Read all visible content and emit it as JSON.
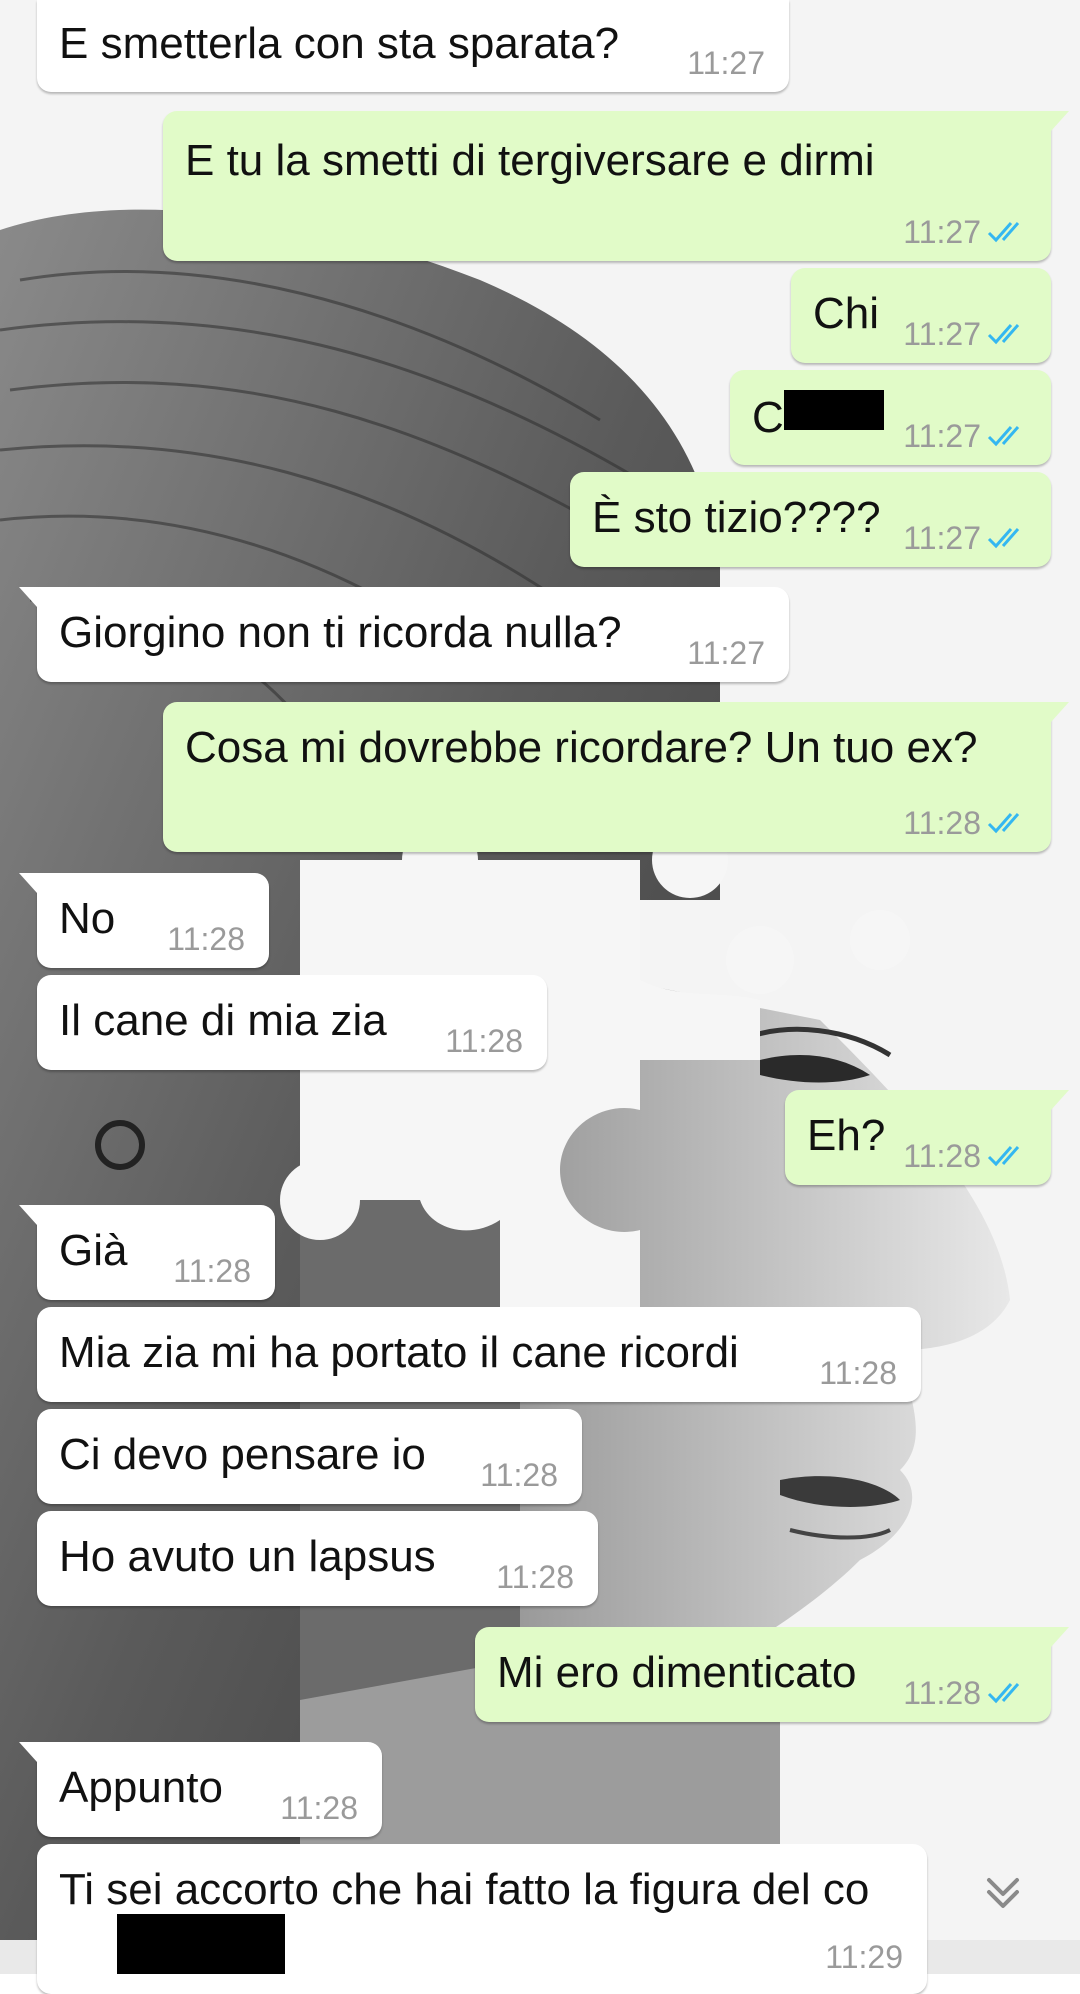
{
  "chat": {
    "messages": [
      {
        "id": "m1",
        "dir": "in",
        "text": "E smetterla con sta sparata?",
        "time": "11:27"
      },
      {
        "id": "m2",
        "dir": "out",
        "text": "E tu la smetti di tergiversare e dirmi",
        "time": "11:27",
        "status": "read"
      },
      {
        "id": "m3",
        "dir": "out",
        "text": "Chi",
        "time": "11:27",
        "status": "read"
      },
      {
        "id": "m4",
        "dir": "out",
        "text": "C",
        "time": "11:27",
        "status": "read",
        "redacted": true
      },
      {
        "id": "m5",
        "dir": "out",
        "text": "È sto tizio????",
        "time": "11:27",
        "status": "read"
      },
      {
        "id": "m6",
        "dir": "in",
        "text": "Giorgino non ti ricorda nulla?",
        "time": "11:27"
      },
      {
        "id": "m7",
        "dir": "out",
        "text": "Cosa mi dovrebbe ricordare? Un tuo ex?",
        "time": "11:28",
        "status": "read"
      },
      {
        "id": "m8",
        "dir": "in",
        "text": "No",
        "time": "11:28"
      },
      {
        "id": "m9",
        "dir": "in",
        "text": "Il cane di mia zia",
        "time": "11:28"
      },
      {
        "id": "m10",
        "dir": "out",
        "text": "Eh?",
        "time": "11:28",
        "status": "read"
      },
      {
        "id": "m11",
        "dir": "in",
        "text": "Già",
        "time": "11:28"
      },
      {
        "id": "m12",
        "dir": "in",
        "text": "Mia zia mi ha portato il cane ricordi",
        "time": "11:28"
      },
      {
        "id": "m13",
        "dir": "in",
        "text": "Ci devo pensare io",
        "time": "11:28"
      },
      {
        "id": "m14",
        "dir": "in",
        "text": "Ho avuto un lapsus",
        "time": "11:28"
      },
      {
        "id": "m15",
        "dir": "out",
        "text": "Mi ero dimenticato",
        "time": "11:28",
        "status": "read"
      },
      {
        "id": "m16",
        "dir": "in",
        "text": "Appunto",
        "time": "11:28"
      },
      {
        "id": "m17",
        "dir": "in",
        "text": "Ti sei accorto che hai fatto la figura del co",
        "time": "11:29",
        "redacted": true
      }
    ]
  },
  "colors": {
    "incoming_bubble": "#ffffff",
    "outgoing_bubble": "#e1fbc8",
    "read_ticks": "#34b7f1",
    "timestamp": "#9a9a9a"
  },
  "icons": {
    "read_status": "double-check-icon",
    "scroll_down": "chevron-double-down-icon"
  }
}
